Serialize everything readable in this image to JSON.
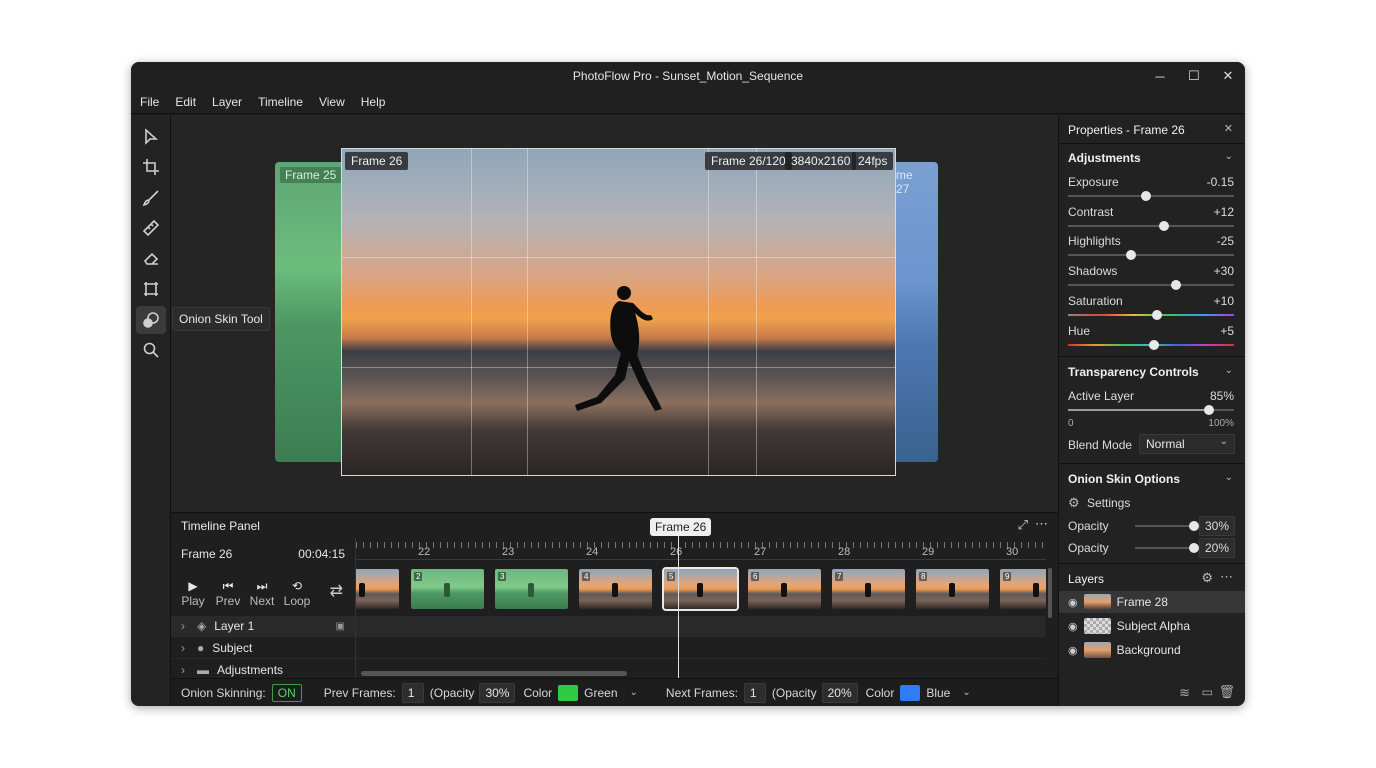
{
  "window": {
    "title": "PhotoFlow Pro - Sunset_Motion_Sequence",
    "minimize": "─",
    "maximize": "☐",
    "close": "✕"
  },
  "menu": [
    "File",
    "Edit",
    "Layer",
    "Timeline",
    "View",
    "Help"
  ],
  "tools": [
    "select-icon",
    "crop-icon",
    "brush-icon",
    "ruler-icon",
    "eraser-icon",
    "transform-icon",
    "onion-skin-icon",
    "zoom-icon"
  ],
  "tooltip": "Onion Skin Tool",
  "canvas": {
    "prev_ghost_label": "Frame 25",
    "next_ghost_label": "me 27",
    "frame_label": "Frame 26",
    "frame_counter": "Frame 26/120",
    "resolution": "3840x2160",
    "fps": "24fps"
  },
  "timeline": {
    "title": "Timeline Panel",
    "playhead_label": "Frame 26",
    "current_frame": "Frame 26",
    "timecode": "00:04:15",
    "ruler_numbers": [
      "22",
      "23",
      "24",
      "26",
      "27",
      "28",
      "29",
      "30"
    ],
    "controls": [
      {
        "icon": "▶",
        "label": "Play"
      },
      {
        "icon": "⏮",
        "label": "Prev"
      },
      {
        "icon": "⏭",
        "label": "Next"
      },
      {
        "icon": "⟲",
        "label": "Loop"
      }
    ],
    "thumb_badges": [
      "",
      "2",
      "3",
      "4",
      "5",
      "6",
      "7",
      "8",
      "9"
    ],
    "layers": [
      "Layer 1",
      "Subject",
      "Adjustments"
    ]
  },
  "onion_bar": {
    "label": "Onion Skinning:",
    "state": "ON",
    "prev_label": "Prev Frames:",
    "prev_value": "1",
    "prev_opacity_label": "(Opacity",
    "prev_opacity": "30%",
    "color_label": "Color",
    "prev_color_name": "Green",
    "prev_color": "#2ecc40",
    "next_label": "Next Frames:",
    "next_value": "1",
    "next_opacity_label": "(Opacity",
    "next_opacity": "20%",
    "next_color_label": "Color",
    "next_color_name": "Blue",
    "next_color": "#2f7cf6"
  },
  "properties": {
    "title": "Properties - Frame 26",
    "adjustments_title": "Adjustments",
    "adjustments": [
      {
        "label": "Exposure",
        "value": "-0.15",
        "level": 0.47
      },
      {
        "label": "Contrast",
        "value": "+12",
        "level": 0.58
      },
      {
        "label": "Highlights",
        "value": "-25",
        "level": 0.38
      },
      {
        "label": "Shadows",
        "value": "+30",
        "level": 0.65
      },
      {
        "label": "Saturation",
        "value": "+10",
        "level": 0.53
      },
      {
        "label": "Hue",
        "value": "+5",
        "level": 0.52
      }
    ],
    "transparency_title": "Transparency Controls",
    "active_layer_label": "Active Layer",
    "active_layer_value": "85%",
    "active_layer_level": 0.85,
    "scale_min": "0",
    "scale_max": "100%",
    "blend_label": "Blend Mode",
    "blend_value": "Normal",
    "onion_title": "Onion Skin Options",
    "settings_label": "Settings",
    "opacity_rows": [
      {
        "label": "Opacity",
        "value": "30%",
        "level": 0.95
      },
      {
        "label": "Opacity",
        "value": "20%",
        "level": 0.95
      }
    ],
    "layers_title": "Layers",
    "layers": [
      "Frame 28",
      "Subject Alpha",
      "Background"
    ]
  }
}
